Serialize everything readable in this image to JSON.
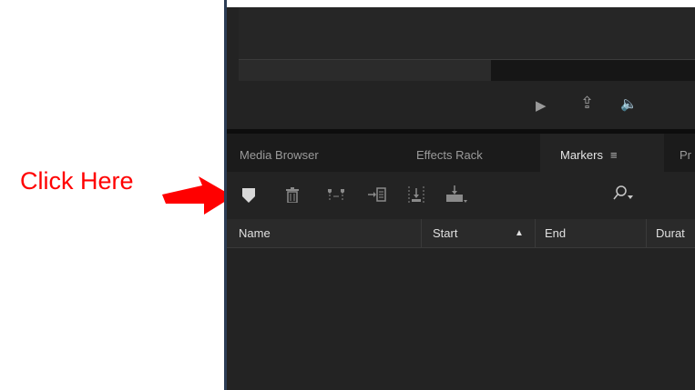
{
  "annotation": {
    "text": "Click Here",
    "color": "#ff0000"
  },
  "transport": {
    "icons": [
      "play-icon",
      "export-icon",
      "volume-icon"
    ],
    "play_glyph": "▶",
    "export_glyph": "⇪",
    "volume_glyph": "🔈"
  },
  "tabs": [
    {
      "label": "Media Browser"
    },
    {
      "label": "Effects Rack"
    },
    {
      "label": "Markers",
      "menu": "≡",
      "active": true
    },
    {
      "label": "Pr"
    }
  ],
  "toolbar": {
    "icons": [
      "add-marker-icon",
      "delete-icon",
      "merge-icon",
      "insert-into-playlist-icon",
      "export-selected-icon",
      "batch-process-icon"
    ],
    "search_glyph": "⌕"
  },
  "table": {
    "columns": [
      "Name",
      "Start",
      "End",
      "Durat"
    ],
    "sort_indicator": "▲"
  },
  "colors": {
    "panel_bg": "#232323",
    "tab_bar_bg": "#1b1b1b",
    "header_bg": "#2a2a2a",
    "accent": "#ff0000"
  }
}
